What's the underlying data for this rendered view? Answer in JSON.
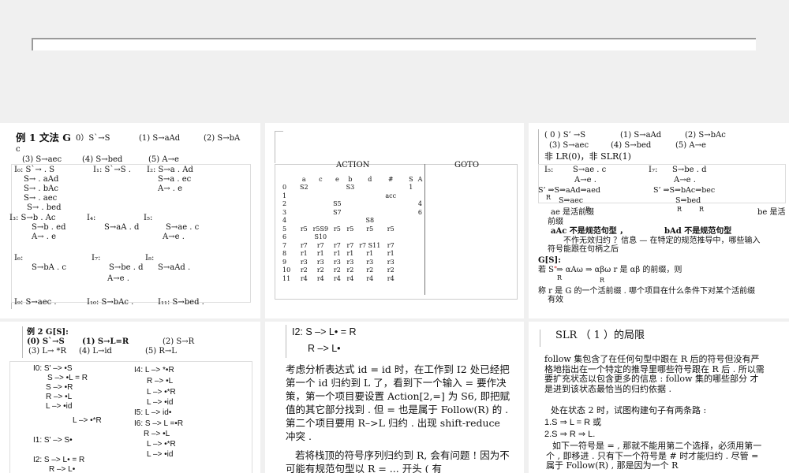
{
  "slide1": {
    "title": "例 1 文法 G",
    "g0": "0）S`→S",
    "g1": "(1) S→aAd",
    "g2": "(2) S→bA",
    "gc": "c",
    "g3": "(3) S→aec",
    "g4": "(4) S→bed",
    "g5": "(5) A→e",
    "i0": "I₀: S`→ . S",
    "i0a": "S→ . aAd",
    "i0b": "S→ . bAc",
    "i0c": "S→ . aec",
    "i0d": "S→ . bed",
    "i1": "I₁: S`→S .",
    "i2": "I₂: S→a . Ad",
    "i2a": "S→a . ec",
    "i2b": "A→ . e",
    "i3": "I₃: S→b . Ac",
    "i3a": "S→b . ed",
    "i3b": "A→ . e",
    "i4": "I₄:",
    "i4a": "S→aA . d",
    "i5": "I₅:",
    "i5a": "S→ae . c",
    "i5b": "A→e .",
    "i6": "I₆:",
    "i6a": "S→bA . c",
    "i7": "I₇:",
    "i7a": "S→be . d",
    "i7b": "A→e .",
    "i8": "I₈:",
    "i8a": "S→aAd .",
    "i9": "I₉: S→aec .",
    "i10": "I₁₀: S→bAc .",
    "i11": "I₁₁: S→bed ."
  },
  "slide2": {
    "action": "ACTION",
    "goto": "GOTO",
    "headers": [
      "",
      "a",
      "c",
      "e",
      "b",
      "d",
      "#",
      "S",
      "A"
    ],
    "rows": [
      [
        "0",
        "S2",
        "",
        "",
        "S3",
        "",
        "",
        "1",
        ""
      ],
      [
        "1",
        "",
        "",
        "",
        "",
        "",
        "acc",
        "",
        ""
      ],
      [
        "2",
        "",
        "",
        "S5",
        "",
        "",
        "",
        "",
        "4"
      ],
      [
        "3",
        "",
        "",
        "S7",
        "",
        "",
        "",
        "",
        "6"
      ],
      [
        "4",
        "",
        "",
        "",
        "",
        "S8",
        "",
        "",
        ""
      ],
      [
        "5",
        "r5",
        "r5S9",
        "r5",
        "r5",
        "r5",
        "r5",
        "",
        ""
      ],
      [
        "6",
        "",
        "S10",
        "",
        "",
        "",
        "",
        "",
        ""
      ],
      [
        "7",
        "r7",
        "r7",
        "r7",
        "r7",
        "r7 S11",
        "r7",
        "",
        ""
      ],
      [
        "8",
        "r1",
        "r1",
        "r1",
        "r1",
        "r1",
        "r1",
        "",
        ""
      ],
      [
        "9",
        "r3",
        "r3",
        "r3",
        "r3",
        "r3",
        "r3",
        "",
        ""
      ],
      [
        "10",
        "r2",
        "r2",
        "r2",
        "r2",
        "r2",
        "r2",
        "",
        ""
      ],
      [
        "11",
        "r4",
        "r4",
        "r4",
        "r4",
        "r4",
        "r4",
        "",
        ""
      ]
    ]
  },
  "slide3": {
    "g0": "( 0 ) S’ →S",
    "g1": "(1) S→aAd",
    "g2": "(2) S→bAc",
    "g3": "(3) S→aec",
    "g4": "(4) S→bed",
    "g5": "(5) A→e",
    "not": "非 LR(0)，非 SLR(1)",
    "i5": "I₅:",
    "i5a": "S→ae . c",
    "i5b": "A→e .",
    "i7": "I₇:",
    "i7a": "S→be . d",
    "i7b": "A→e .",
    "d1": "S’ ⇒S⇒aAd⇒aed",
    "d2": "S’ ⇒S⇒bAc⇒bec",
    "d3": "S⇒aec",
    "d4": "S⇒bed",
    "r1": "R",
    "r2": "R",
    "r3": "R",
    "r4": "R",
    "ae": "ae 是活前缀",
    "be": "be 是活",
    "prefix": "前缀",
    "aac": "aAc 不是规范句型 ，",
    "bad": "bAd 不是规范句型",
    "line1": "不作无效归约 ？信息 — 在特定的规范推导中，哪些输入",
    "line2": "符号能跟在句柄之后",
    "gs": "G[S]:",
    "if": "若 S ⇒ αAω ⇒ αβω r 是 αβ 的前缀，则",
    "ra": "R",
    "rb": "R",
    "call": "称 r 是 G 的一个活前缀 . 哪个项目在什么条件下对某个活前缀",
    "valid": "有效"
  },
  "slide4": {
    "title": "例 2 G[S]:",
    "g0": "(0) S`→S",
    "g1": "(1) S→L=R",
    "g2": "(2) S→R",
    "g3": "(3) L→ *R",
    "g4": "(4) L→id",
    "g5": "(5) R→L",
    "i0": "I0: S' –> •S",
    "i0a": "S –> •L = R",
    "i0b": "S –> •R",
    "i0c": "R –> •L",
    "i0d": "L –> •id",
    "i0e": "L –> •*R",
    "i1": "I1: S' –> S•",
    "i2": "I2: S –> L• = R",
    "i2a": "R –> L•",
    "i4": "I4: L –> *•R",
    "i4a": "R –> •L",
    "i4b": "L –> •*R",
    "i4c": "L –> •id",
    "i5": "I5: L –> id•",
    "i6": "I6: S –> L =•R",
    "i6a": "R –> •L",
    "i6b": "L –> •*R",
    "i6c": "L –> •id"
  },
  "slide5": {
    "h1": "I2: S –> L• = R",
    "h2": "R –> L•",
    "p1": "考虑分析表达式 id = id 时，在工作到 I2 处已经把第一个 id 归约到 L 了，看到下一个输入 = 要作决策，第一个项目要设置 Action[2,=] 为 S6, 即把赋值的其它部分找到 . 但 = 也是属于 Follow(R) 的 . 第二个项目要用 R–>L 归约 . 出现 shift-reduce 冲突 .",
    "p2": "若将栈顶的符号序列归约到 R, 会有问题 ! 因为不可能有规范句型以 R = ... 开头 ( 有"
  },
  "slide6": {
    "title": "SLR （ 1 ）的局限",
    "p1": "follow 集包含了在任何句型中跟在 R 后的符号但没有严格地指出在一个特定的推导里哪些符号跟在 R 后 . 所以需要扩充状态以包含更多的信息 : follow 集的哪些部分 才是进到该状态最恰当的归约依据 .",
    "p2": "处在状态 2 时，试图构建句子有两条路 :",
    "l1": "1.S ⇒ L = R 或",
    "l2": "2.S ⇒ R ⇒ L.",
    "p3": "如下一符号是 = , 那就不能用第二个选择，必须用第一个 , 即移进 . 只有下一个符号是 # 时才能归约 . 尽管 = 属于 Follow(R) , 那是因为一个 R"
  }
}
